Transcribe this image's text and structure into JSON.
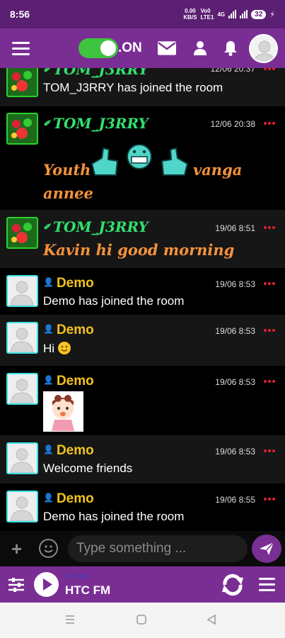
{
  "status_bar": {
    "time": "8:56",
    "net1_top": "0.00",
    "net1_bottom": "KB/S",
    "net2_top": "Vo0",
    "net2_bottom": "LTE1",
    "net3_top": "4G",
    "battery": "32"
  },
  "header": {
    "toggle_label": ".ON"
  },
  "messages": [
    {
      "user": "TOM_J3RRY",
      "time": "12/06 20:37",
      "text": "TOM_J3RRY has joined the room"
    },
    {
      "user": "TOM_J3RRY",
      "time": "12/06 20:38",
      "text_before": "Youth",
      "text_after": "vanga",
      "text_line2": "annee"
    },
    {
      "user": "TOM_J3RRY",
      "time": "19/06 8:51",
      "text": "Kavin hi good morning"
    },
    {
      "user": "Demo",
      "time": "19/06 8:53",
      "text": "Demo has joined the room"
    },
    {
      "user": "Demo",
      "time": "19/06 8:53",
      "text": "Hi"
    },
    {
      "user": "Demo",
      "time": "19/06 8:53",
      "text": ""
    },
    {
      "user": "Demo",
      "time": "19/06 8:53",
      "text": "Welcome friends"
    },
    {
      "user": "Demo",
      "time": "19/06 8:55",
      "text": "Demo has joined the room"
    }
  ],
  "composer": {
    "placeholder": "Type something ..."
  },
  "player": {
    "status": "Online",
    "station": "HTC FM"
  },
  "colors": {
    "accent": "#7a2e94",
    "toggle_on": "#3ec43e",
    "username_green": "#32e06e",
    "username_yellow": "#f2c31a",
    "message_orange": "#f5923a",
    "menu_dots": "#e0222b"
  }
}
